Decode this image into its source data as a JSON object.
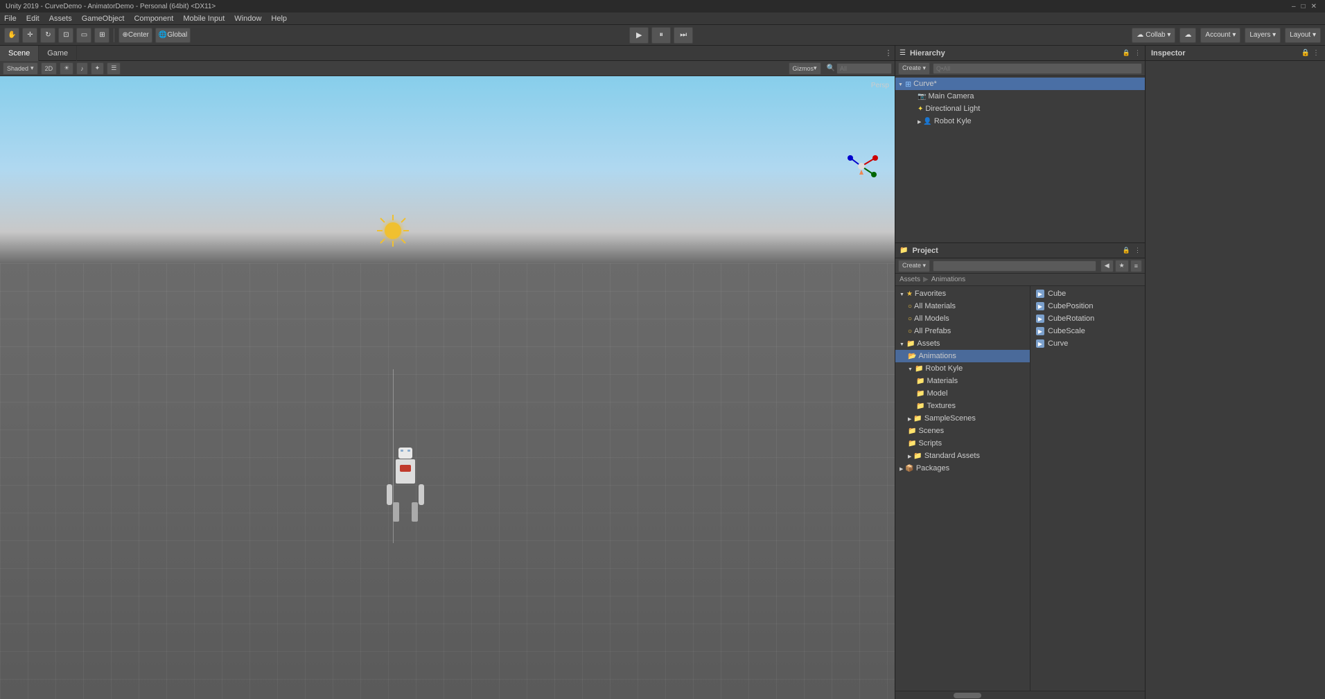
{
  "app": {
    "title": "Unity 2019 - CurveDemo - AnimatorDemo - Personal (64bit) <DX11>"
  },
  "menubar": {
    "items": [
      "File",
      "Edit",
      "Assets",
      "GameObject",
      "Component",
      "Mobile Input",
      "Window",
      "Help"
    ]
  },
  "toolbar": {
    "transform_tools": [
      "hand",
      "move",
      "rotate",
      "scale",
      "rect",
      "multi"
    ],
    "pivot_btn": "Center",
    "global_btn": "Global",
    "collab_btn": "Collab ▾",
    "account_btn": "Account ▾",
    "layers_btn": "Layers ▾",
    "layout_btn": "Layout ▾"
  },
  "scene": {
    "tab_scene": "Scene",
    "tab_game": "Game",
    "shading_mode": "Shaded",
    "gizmos_btn": "Gizmos",
    "search_placeholder": "All",
    "perspective_label": "Persp"
  },
  "hierarchy": {
    "title": "Hierarchy",
    "create_btn": "Create ▾",
    "search_placeholder": "Q•All",
    "scene_name": "Curve*",
    "items": [
      {
        "id": "main-camera",
        "label": "Main Camera",
        "indent": 1,
        "type": "camera"
      },
      {
        "id": "directional-light",
        "label": "Directional Light",
        "indent": 1,
        "type": "light"
      },
      {
        "id": "robot-kyle",
        "label": "Robot Kyle",
        "indent": 1,
        "type": "prefab",
        "expanded": false
      }
    ]
  },
  "project": {
    "title": "Project",
    "create_btn": "Create ▾",
    "search_placeholder": "",
    "breadcrumb_assets": "Assets",
    "breadcrumb_sep": "▶",
    "breadcrumb_animations": "Animations",
    "tree": {
      "favorites": {
        "label": "Favorites",
        "items": [
          "All Materials",
          "All Models",
          "All Prefabs"
        ]
      },
      "assets": {
        "label": "Assets",
        "children": [
          {
            "label": "Animations",
            "selected": true
          },
          {
            "label": "Robot Kyle",
            "expanded": true,
            "children": [
              "Materials",
              "Model",
              "Textures"
            ]
          },
          {
            "label": "SampleScenes"
          },
          {
            "label": "Scenes"
          },
          {
            "label": "Scripts"
          },
          {
            "label": "Standard Assets"
          }
        ]
      },
      "packages": {
        "label": "Packages"
      }
    },
    "animations_assets": [
      {
        "label": "Cube"
      },
      {
        "label": "CubePosition"
      },
      {
        "label": "CubeRotation"
      },
      {
        "label": "CubeScale"
      },
      {
        "label": "Curve"
      }
    ]
  },
  "inspector": {
    "title": "Inspector"
  },
  "icons": {
    "play": "▶",
    "pause": "⏸",
    "step": "⏭",
    "arrow_right": "▶",
    "arrow_down": "▼",
    "collapse": "–",
    "expand": "+"
  }
}
